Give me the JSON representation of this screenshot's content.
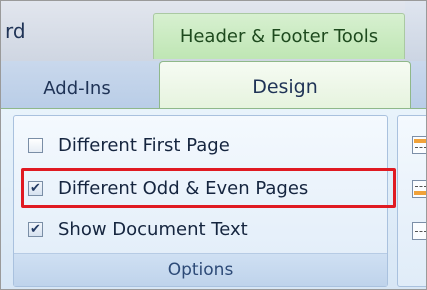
{
  "title_bar": {
    "app_title_fragment": "rd",
    "contextual_tab_group": "Header & Footer Tools"
  },
  "tabs": [
    {
      "label": "Add-Ins",
      "selected": false
    },
    {
      "label": "Design",
      "selected": true
    }
  ],
  "options_group": {
    "label": "Options",
    "items": [
      {
        "label": "Different First Page",
        "checked": false
      },
      {
        "label": "Different Odd & Even Pages",
        "checked": true,
        "highlighted": true
      },
      {
        "label": "Show Document Text",
        "checked": true
      }
    ]
  },
  "colors": {
    "contextual_green": "#bfe6b4",
    "highlight_red": "#e01a22",
    "ribbon_blue": "#d7e6f5"
  },
  "icons": [
    "header-position-icon",
    "footer-position-icon",
    "insert-alignment-tab-icon"
  ]
}
